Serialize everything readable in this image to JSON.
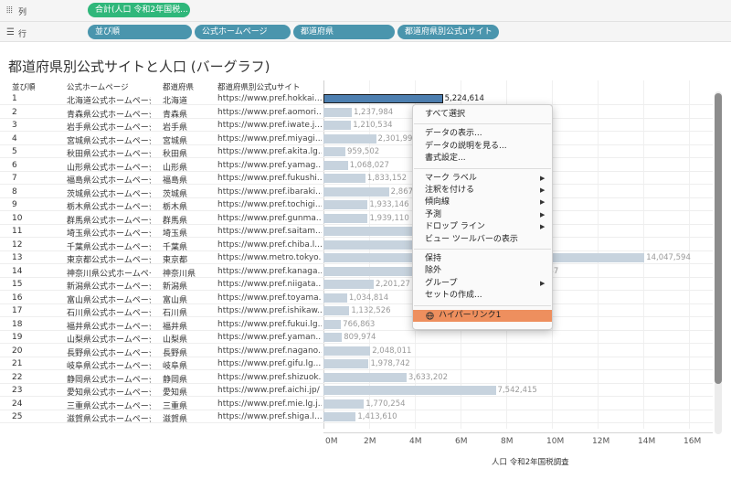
{
  "shelves": {
    "columns": {
      "icon": "columns-icon",
      "label": "列",
      "pills": [
        "合計(人口 令和2年国税..."
      ]
    },
    "rows": {
      "icon": "rows-icon",
      "label": "行",
      "pills": [
        "並び順",
        "公式ホームページ",
        "都道府県",
        "都道府県別公式uサイト"
      ]
    }
  },
  "title": "都道府県別公式サイトと人口 (バーグラフ)",
  "headers": {
    "index": "並び順",
    "page": "公式ホームページ",
    "prefecture": "都道府県",
    "url": "都道府県別公式uサイト"
  },
  "rows": [
    {
      "index": "1",
      "page": "北海道公式ホームページ",
      "prefecture": "北海道",
      "url": "https://www.pref.hokkai...",
      "value": 5224614,
      "label": "5,224,614"
    },
    {
      "index": "2",
      "page": "青森県公式ホームページ",
      "prefecture": "青森県",
      "url": "https://www.pref.aomori...",
      "value": 1237984,
      "label": "1,237,984"
    },
    {
      "index": "3",
      "page": "岩手県公式ホームページ",
      "prefecture": "岩手県",
      "url": "https://www.pref.iwate.j...",
      "value": 1210534,
      "label": "1,210,534"
    },
    {
      "index": "4",
      "page": "宮城県公式ホームページ",
      "prefecture": "宮城県",
      "url": "https://www.pref.miyagi...",
      "value": 2301996,
      "label": "2,301,99"
    },
    {
      "index": "5",
      "page": "秋田県公式ホームページ",
      "prefecture": "秋田県",
      "url": "https://www.pref.akita.lg...",
      "value": 959502,
      "label": "959,502"
    },
    {
      "index": "6",
      "page": "山形県公式ホームページ",
      "prefecture": "山形県",
      "url": "https://www.pref.yamag...",
      "value": 1068027,
      "label": "1,068,027"
    },
    {
      "index": "7",
      "page": "福島県公式ホームページ",
      "prefecture": "福島県",
      "url": "https://www.pref.fukushi...",
      "value": 1833152,
      "label": "1,833,152"
    },
    {
      "index": "8",
      "page": "茨城県公式ホームページ",
      "prefecture": "茨城県",
      "url": "https://www.pref.ibaraki...",
      "value": 2867009,
      "label": "2,867"
    },
    {
      "index": "9",
      "page": "栃木県公式ホームページ",
      "prefecture": "栃木県",
      "url": "https://www.pref.tochigi...",
      "value": 1933146,
      "label": "1,933,146"
    },
    {
      "index": "10",
      "page": "群馬県公式ホームページ",
      "prefecture": "群馬県",
      "url": "https://www.pref.gunma...",
      "value": 1939110,
      "label": "1,939,110"
    },
    {
      "index": "11",
      "page": "埼玉県公式ホームページ",
      "prefecture": "埼玉県",
      "url": "https://www.pref.saitam...",
      "value": 7344765,
      "label": ""
    },
    {
      "index": "12",
      "page": "千葉県公式ホームページ",
      "prefecture": "千葉県",
      "url": "https://www.pref.chiba.l...",
      "value": 6284480,
      "label": ""
    },
    {
      "index": "13",
      "page": "東京都公式ホームページ",
      "prefecture": "東京都",
      "url": "https://www.metro.tokyo...",
      "value": 14047594,
      "label": "14,047,594"
    },
    {
      "index": "14",
      "page": "神奈川県公式ホームページ",
      "prefecture": "神奈川県",
      "url": "https://www.pref.kanaga...",
      "value": 9237337,
      "label": "7,337"
    },
    {
      "index": "15",
      "page": "新潟県公式ホームページ",
      "prefecture": "新潟県",
      "url": "https://www.pref.niigata...",
      "value": 2201272,
      "label": "2,201,27"
    },
    {
      "index": "16",
      "page": "富山県公式ホームページ",
      "prefecture": "富山県",
      "url": "https://www.pref.toyama...",
      "value": 1034814,
      "label": "1,034,814"
    },
    {
      "index": "17",
      "page": "石川県公式ホームページ",
      "prefecture": "石川県",
      "url": "https://www.pref.ishikaw...",
      "value": 1132526,
      "label": "1,132,526"
    },
    {
      "index": "18",
      "page": "福井県公式ホームページ",
      "prefecture": "福井県",
      "url": "https://www.pref.fukui.lg...",
      "value": 766863,
      "label": "766,863"
    },
    {
      "index": "19",
      "page": "山梨県公式ホームページ",
      "prefecture": "山梨県",
      "url": "https://www.pref.yaman...",
      "value": 809974,
      "label": "809,974"
    },
    {
      "index": "20",
      "page": "長野県公式ホームページ",
      "prefecture": "長野県",
      "url": "https://www.pref.nagano...",
      "value": 2048011,
      "label": "2,048,011"
    },
    {
      "index": "21",
      "page": "岐阜県公式ホームページ",
      "prefecture": "岐阜県",
      "url": "https://www.pref.gifu.lg...",
      "value": 1978742,
      "label": "1,978,742"
    },
    {
      "index": "22",
      "page": "静岡県公式ホームページ",
      "prefecture": "静岡県",
      "url": "https://www.pref.shizuok...",
      "value": 3633202,
      "label": "3,633,202"
    },
    {
      "index": "23",
      "page": "愛知県公式ホームページ",
      "prefecture": "愛知県",
      "url": "https://www.pref.aichi.jp/",
      "value": 7542415,
      "label": "7,542,415"
    },
    {
      "index": "24",
      "page": "三重県公式ホームページ",
      "prefecture": "三重県",
      "url": "https://www.pref.mie.lg.j...",
      "value": 1770254,
      "label": "1,770,254"
    },
    {
      "index": "25",
      "page": "滋賀県公式ホームページ",
      "prefecture": "滋賀県",
      "url": "https://www.pref.shiga.l...",
      "value": 1413610,
      "label": "1,413,610"
    }
  ],
  "selected_row": 0,
  "axis": {
    "ticks": [
      "0M",
      "2M",
      "4M",
      "6M",
      "8M",
      "10M",
      "12M",
      "14M",
      "16M"
    ],
    "title": "人口 令和2年国税調査"
  },
  "chart_data": {
    "type": "bar",
    "orientation": "horizontal",
    "categories": [
      "北海道",
      "青森県",
      "岩手県",
      "宮城県",
      "秋田県",
      "山形県",
      "福島県",
      "茨城県",
      "栃木県",
      "群馬県",
      "埼玉県",
      "千葉県",
      "東京都",
      "神奈川県",
      "新潟県",
      "富山県",
      "石川県",
      "福井県",
      "山梨県",
      "長野県",
      "岐阜県",
      "静岡県",
      "愛知県",
      "三重県",
      "滋賀県"
    ],
    "values": [
      5224614,
      1237984,
      1210534,
      2301996,
      959502,
      1068027,
      1833152,
      2867009,
      1933146,
      1939110,
      7344765,
      6284480,
      14047594,
      9237337,
      2201272,
      1034814,
      1132526,
      766863,
      809974,
      2048011,
      1978742,
      3633202,
      7542415,
      1770254,
      1413610
    ],
    "xlabel": "人口 令和2年国税調査",
    "xlim": [
      0,
      17000000
    ],
    "bar_color": "#c7d3de",
    "selected_color": "#4d7fb0"
  },
  "context_menu": {
    "sections": [
      [
        {
          "label": "すべて選択",
          "submenu": false
        }
      ],
      [
        {
          "label": "データの表示...",
          "submenu": false
        },
        {
          "label": "データの説明を見る...",
          "submenu": false
        },
        {
          "label": "書式設定...",
          "submenu": false
        }
      ],
      [
        {
          "label": "マーク ラベル",
          "submenu": true
        },
        {
          "label": "注釈を付ける",
          "submenu": true
        },
        {
          "label": "傾向線",
          "submenu": true
        },
        {
          "label": "予測",
          "submenu": true
        },
        {
          "label": "ドロップ ライン",
          "submenu": true
        },
        {
          "label": "ビュー ツールバーの表示",
          "submenu": false
        }
      ],
      [
        {
          "label": "保持",
          "submenu": false
        },
        {
          "label": "除外",
          "submenu": false
        },
        {
          "label": "グループ",
          "submenu": true
        },
        {
          "label": "セットの作成...",
          "submenu": false
        }
      ],
      [
        {
          "label": "ハイパーリンク1",
          "submenu": false,
          "highlighted": true,
          "icon": "globe-icon"
        }
      ]
    ],
    "submenu_arrow": "▶"
  },
  "colors": {
    "pill_green": "#2fb77a",
    "pill_blue": "#4a95ad",
    "menu_highlight": "#ee8f5e"
  }
}
